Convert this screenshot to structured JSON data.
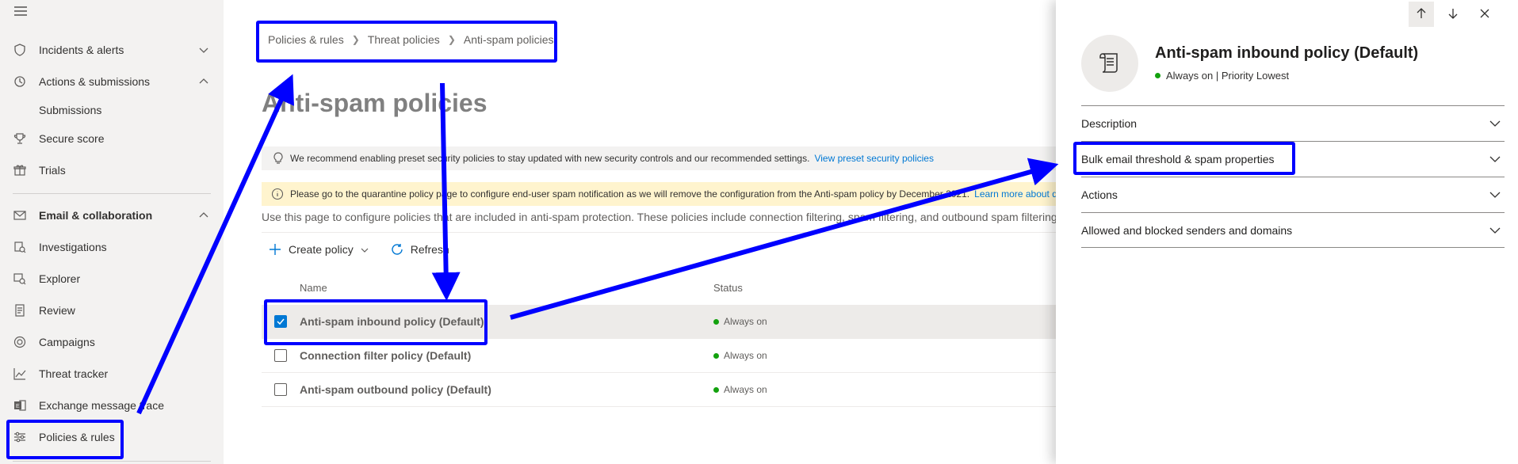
{
  "sidebar": {
    "items": [
      {
        "label": "Incidents & alerts",
        "icon": "shield-icon",
        "expanded": false
      },
      {
        "label": "Actions & submissions",
        "icon": "actions-icon",
        "expanded": true
      },
      {
        "label": "Secure score",
        "icon": "trophy-icon"
      },
      {
        "label": "Trials",
        "icon": "gift-icon"
      },
      {
        "label": "Email & collaboration",
        "icon": "mail-icon",
        "expanded": true
      },
      {
        "label": "Investigations",
        "icon": "investigation-icon"
      },
      {
        "label": "Explorer",
        "icon": "explorer-icon"
      },
      {
        "label": "Review",
        "icon": "review-icon"
      },
      {
        "label": "Campaigns",
        "icon": "target-icon"
      },
      {
        "label": "Threat tracker",
        "icon": "chart-icon"
      },
      {
        "label": "Exchange message trace",
        "icon": "exchange-icon"
      },
      {
        "label": "Policies & rules",
        "icon": "sliders-icon"
      }
    ],
    "submissions_label": "Submissions"
  },
  "breadcrumb": [
    "Policies & rules",
    "Threat policies",
    "Anti-spam policies"
  ],
  "page_title": "Anti-spam policies",
  "info_bar": {
    "text": "We recommend enabling preset security policies to stay updated with new security controls and our recommended settings.",
    "link": "View preset security policies"
  },
  "warning_bar": {
    "text": "Please go to the quarantine policy page to configure end-user spam notification as we will remove the configuration from the Anti-spam policy by December 2021.",
    "link": "Learn more about q"
  },
  "description": "Use this page to configure policies that are included in anti-spam protection. These policies include connection filtering, spam filtering, and outbound spam filtering.",
  "toolbar": {
    "create_label": "Create policy",
    "refresh_label": "Refresh"
  },
  "table": {
    "columns": [
      "Name",
      "Status"
    ],
    "rows": [
      {
        "name": "Anti-spam inbound policy (Default)",
        "status": "Always on",
        "selected": true
      },
      {
        "name": "Connection filter policy (Default)",
        "status": "Always on",
        "selected": false
      },
      {
        "name": "Anti-spam outbound policy (Default)",
        "status": "Always on",
        "selected": false
      }
    ]
  },
  "panel": {
    "title": "Anti-spam inbound policy (Default)",
    "subtitle": "Always on | Priority Lowest",
    "sections": [
      "Description",
      "Bulk email threshold & spam properties",
      "Actions",
      "Allowed and blocked senders and domains"
    ]
  },
  "colors": {
    "accent": "#0078d4",
    "annotation": "#0000ff",
    "status_on": "#13a10e"
  }
}
